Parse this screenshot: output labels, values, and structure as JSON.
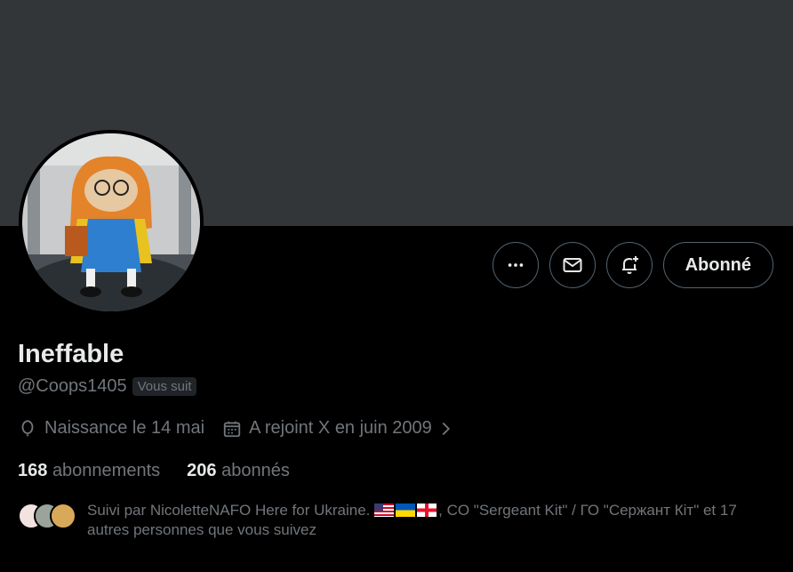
{
  "profile": {
    "display_name": "Ineffable",
    "handle": "@Coops1405",
    "follows_you_badge": "Vous suit",
    "birthday": "Naissance le 14 mai",
    "joined": "A rejoint X en juin 2009",
    "following_count": "168",
    "following_label": "abonnements",
    "followers_count": "206",
    "followers_label": "abonnés",
    "followed_by_prefix": "Suivi par NicoletteNAFO Here for Ukraine.",
    "followed_by_suffix": ", CO \"Sergeant Kit\" / ГО \"Сержант Кіт\" et 17 autres personnes que vous suivez",
    "flags": [
      "us-flag",
      "ukraine-flag",
      "georgia-flag"
    ]
  },
  "actions": {
    "follow_label": "Abonné",
    "icons": [
      "more-icon",
      "message-icon",
      "notifications-icon"
    ]
  },
  "colors": {
    "background": "#000000",
    "banner": "#333639",
    "text_primary": "#e7e9ea",
    "text_secondary": "#71767b",
    "border": "#536471"
  }
}
